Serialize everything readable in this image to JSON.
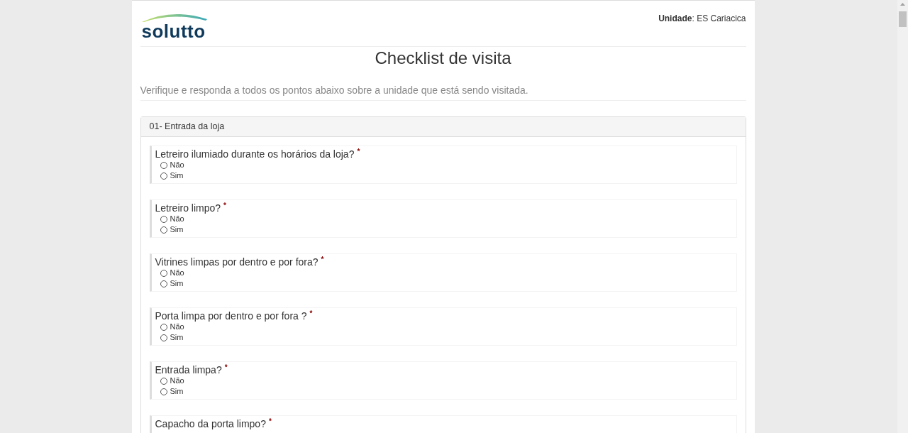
{
  "header": {
    "logo_text": "solutto",
    "unit_label": "Unidade",
    "unit_value": ": ES Cariacica"
  },
  "title": "Checklist de visita",
  "subtitle": "Verifique e responda a todos os pontos abaixo sobre a unidade que está sendo visitada.",
  "section": {
    "heading": "01- Entrada da loja",
    "questions": [
      {
        "text": "Letreiro ilumiado durante os horários da loja?",
        "required_mark": "*",
        "options": [
          {
            "label": "Não",
            "selected": false
          },
          {
            "label": "Sim",
            "selected": false
          }
        ]
      },
      {
        "text": "Letreiro limpo?",
        "required_mark": "*",
        "options": [
          {
            "label": "Não",
            "selected": false
          },
          {
            "label": "Sim",
            "selected": false
          }
        ]
      },
      {
        "text": "Vitrines limpas por dentro e por fora?",
        "required_mark": "*",
        "options": [
          {
            "label": "Não",
            "selected": false
          },
          {
            "label": "Sim",
            "selected": false
          }
        ]
      },
      {
        "text": "Porta limpa por dentro e por fora ?",
        "required_mark": "*",
        "options": [
          {
            "label": "Não",
            "selected": false
          },
          {
            "label": "Sim",
            "selected": false
          }
        ]
      },
      {
        "text": "Entrada limpa?",
        "required_mark": "*",
        "options": [
          {
            "label": "Não",
            "selected": false
          },
          {
            "label": "Sim",
            "selected": false
          }
        ]
      },
      {
        "text": "Capacho da porta limpo?",
        "required_mark": "*"
      }
    ]
  }
}
